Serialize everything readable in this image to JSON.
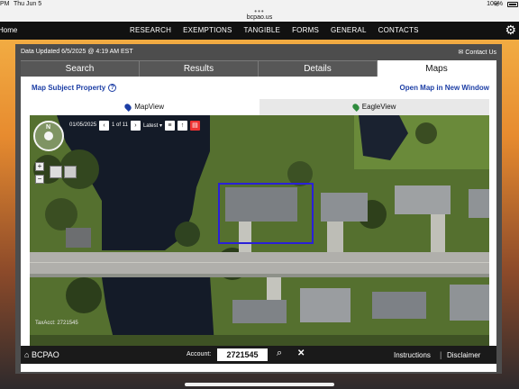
{
  "status_bar": {
    "time": "PM",
    "date": "Thu Jun 5",
    "battery": "100%"
  },
  "browser": {
    "url": "bcpao.us",
    "dots": "•••"
  },
  "site_nav": {
    "home": "Home",
    "items": [
      "RESEARCH",
      "EXEMPTIONS",
      "TANGIBLE",
      "FORMS",
      "GENERAL",
      "CONTACTS"
    ],
    "gear_icon": "gear-icon"
  },
  "panel": {
    "updated": "Data Updated 6/5/2025 @ 4:19 AM EST",
    "contact": "Contact Us"
  },
  "tabs": [
    "Search",
    "Results",
    "Details",
    "Maps"
  ],
  "active_tab": "Maps",
  "maps": {
    "subject_link": "Map Subject Property",
    "open_new_window": "Open Map in New Window",
    "view_tabs": [
      "MapView",
      "EagleView"
    ],
    "colors": {
      "mapview_pin": "#1c3ea5",
      "eagleview_pin": "#2e8b3d",
      "boundary": "#2a20d8"
    },
    "imagery": {
      "date": "01/05/2025",
      "page": "1 of 11",
      "latest": "Latest ▾"
    },
    "tax_acct": "TaxAcct: 2721545"
  },
  "bottom_bar": {
    "brand": "BCPAO",
    "account_label": "Account:",
    "account_value": "2721545",
    "instructions": "Instructions",
    "separator": "|",
    "disclaimer": "Disclaimer"
  }
}
